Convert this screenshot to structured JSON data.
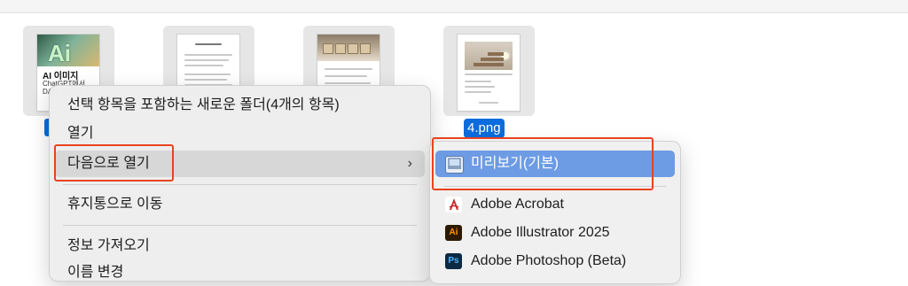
{
  "files": [
    {
      "name": "",
      "thumb_title": "AI 이미지",
      "thumb_sub": "ChatGPT에서 DALL·E로 생성"
    },
    {
      "name": ""
    },
    {
      "name": ""
    },
    {
      "name": "4.png",
      "selected": true
    }
  ],
  "context_menu": {
    "items": [
      {
        "label": "선택 항목을 포함하는 새로운 폴더(4개의 항목)"
      },
      {
        "label": "열기"
      },
      {
        "label": "다음으로 열기",
        "has_submenu": true,
        "highlighted": true
      },
      {
        "label": "휴지통으로 이동"
      },
      {
        "label": "정보 가져오기"
      },
      {
        "label": "이름 변경"
      }
    ],
    "chevron": "›"
  },
  "submenu": {
    "items": [
      {
        "label": "미리보기(기본)",
        "icon": "preview-app-icon",
        "active": true
      },
      {
        "label": "Adobe Acrobat",
        "icon": "acrobat-icon",
        "icon_color": "#b71c1c",
        "glyph": "A"
      },
      {
        "label": "Adobe Illustrator 2025",
        "icon": "illustrator-icon",
        "icon_color": "#2d1a04",
        "glyph": "Ai",
        "glyph_color": "#ff9a00"
      },
      {
        "label": "Adobe Photoshop (Beta)",
        "icon": "photoshop-icon",
        "icon_color": "#0b2a44",
        "glyph": "Ps",
        "glyph_color": "#4fb3ff"
      }
    ]
  },
  "colors": {
    "selection": "#0a6cdd",
    "submenu_active": "#6d9be4",
    "annotation": "#e8431f"
  }
}
